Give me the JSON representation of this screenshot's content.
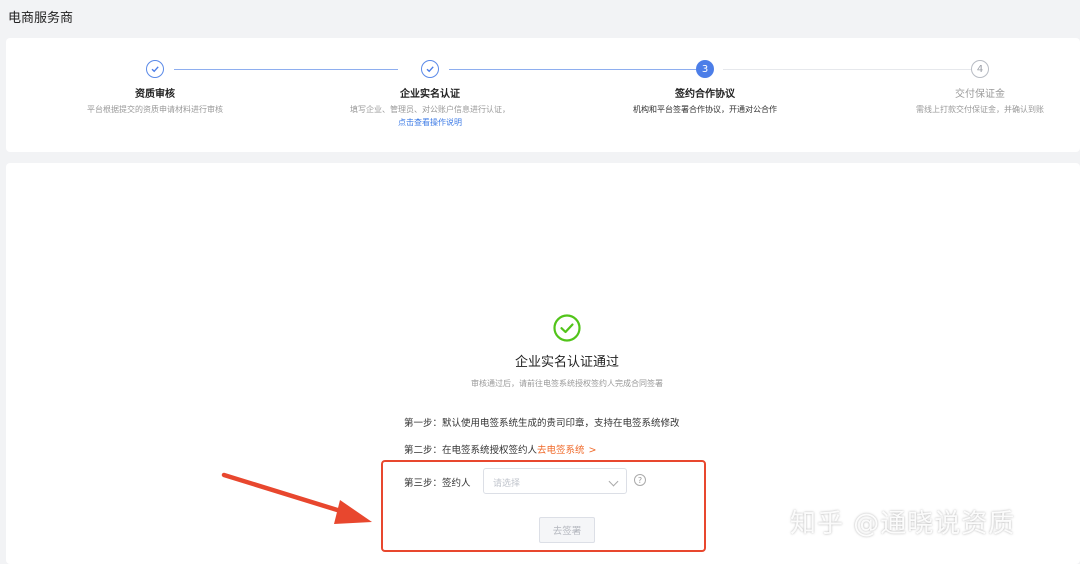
{
  "header": {
    "title": "电商服务商"
  },
  "steps": [
    {
      "title": "资质审核",
      "desc": "平台根据提交的资质申请材料进行审核",
      "status": "done",
      "number": ""
    },
    {
      "title": "企业实名认证",
      "desc": "填写企业、管理员、对公账户信息进行认证，",
      "link": "点击查看操作说明",
      "status": "done",
      "number": ""
    },
    {
      "title": "签约合作协议",
      "desc": "机构和平台签署合作协议，开通对公合作",
      "status": "active",
      "number": "3"
    },
    {
      "title": "交付保证金",
      "desc": "需线上打款交付保证金，并确认到账",
      "status": "todo",
      "number": "4"
    }
  ],
  "result": {
    "title": "企业实名认证通过",
    "subtitle": "审核通过后，请前往电签系统授权签约人完成合同签署"
  },
  "instructions": {
    "step1": "第一步：默认使用电签系统生成的贵司印章，支持在电签系统修改",
    "step2_prefix": "第二步：在电签系统授权签约人",
    "step2_link": "去电签系统",
    "step2_chevron": ">",
    "step3_label": "第三步：签约人"
  },
  "signer_select": {
    "placeholder": "请选择",
    "help": "?"
  },
  "sign_button": {
    "label": "去签署"
  },
  "watermark": "知乎 @通晓说资质",
  "colors": {
    "primary": "#4c7ee8",
    "success": "#52c41a",
    "link_orange": "#f06a2a",
    "annotation_red": "#e8472e"
  }
}
